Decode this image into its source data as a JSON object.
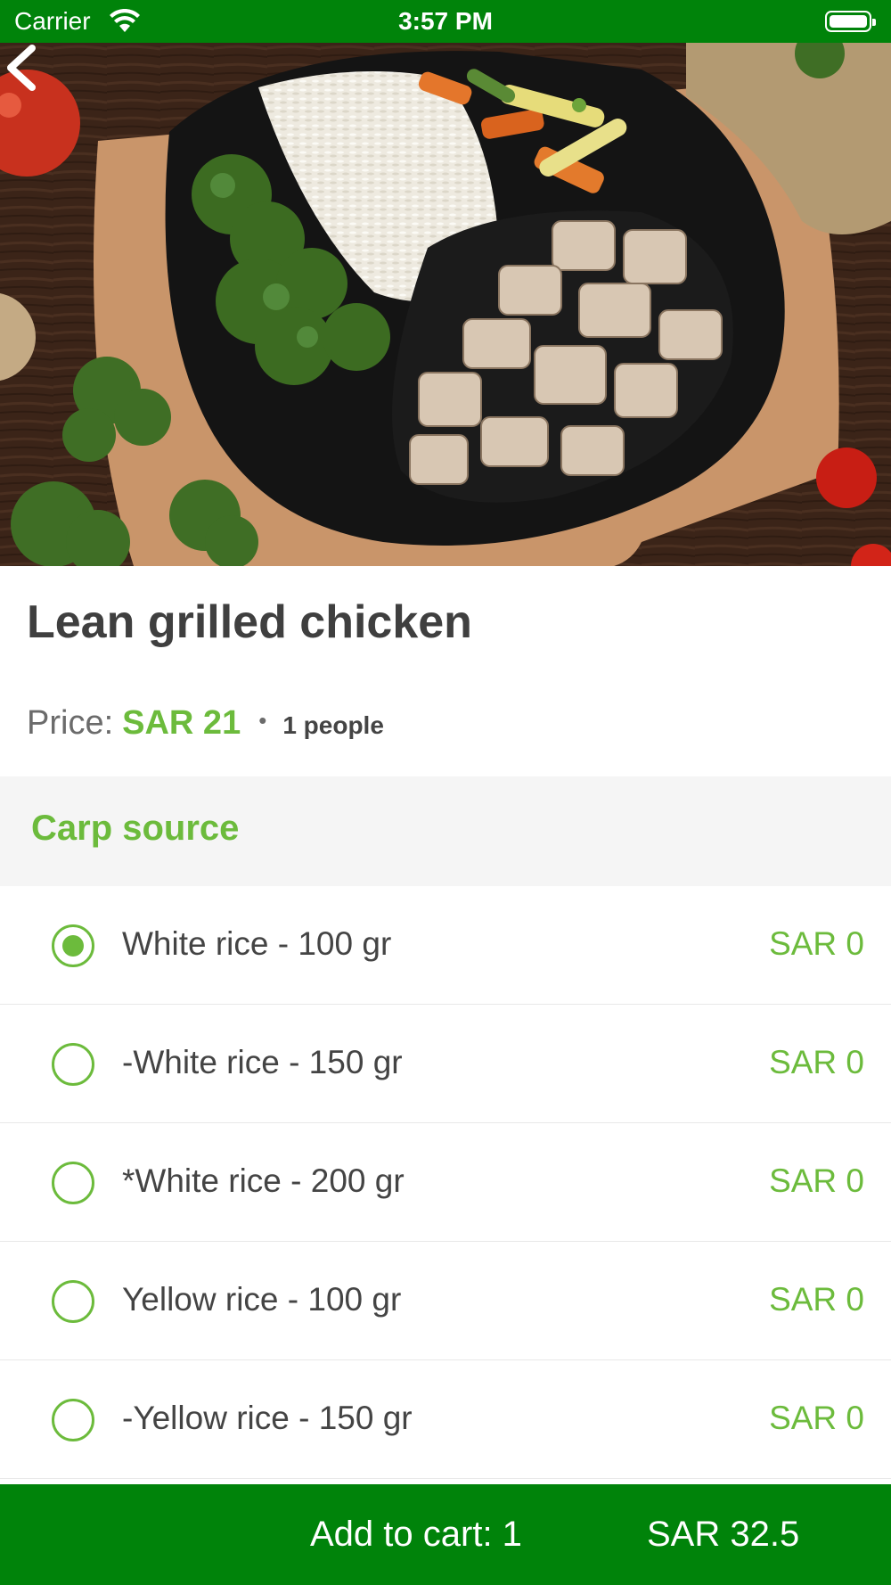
{
  "status_bar": {
    "carrier": "Carrier",
    "time": "3:57 PM",
    "icons": [
      "wifi-icon",
      "battery-icon"
    ]
  },
  "colors": {
    "brand_green": "#00830a",
    "accent_green": "#6cbb3c",
    "text_dark": "#3f3f3f",
    "section_bg": "#f5f5f5"
  },
  "hero": {
    "back_icon": "chevron-left-icon"
  },
  "dish": {
    "title": "Lean grilled chicken",
    "price_label": "Price:",
    "price_value": "SAR 21",
    "separator": "•",
    "people": "1 people"
  },
  "section": {
    "title": "Carp source"
  },
  "options": [
    {
      "label": "White rice - 100 gr",
      "price": "SAR 0",
      "selected": true
    },
    {
      "label": "-White rice - 150 gr",
      "price": "SAR 0",
      "selected": false
    },
    {
      "label": "*White rice - 200 gr",
      "price": "SAR 0",
      "selected": false
    },
    {
      "label": "Yellow rice - 100 gr",
      "price": "SAR 0",
      "selected": false
    },
    {
      "label": "-Yellow rice - 150 gr",
      "price": "SAR 0",
      "selected": false
    }
  ],
  "bottom_bar": {
    "add_to_cart": "Add to cart: 1",
    "total": "SAR 32.5"
  }
}
